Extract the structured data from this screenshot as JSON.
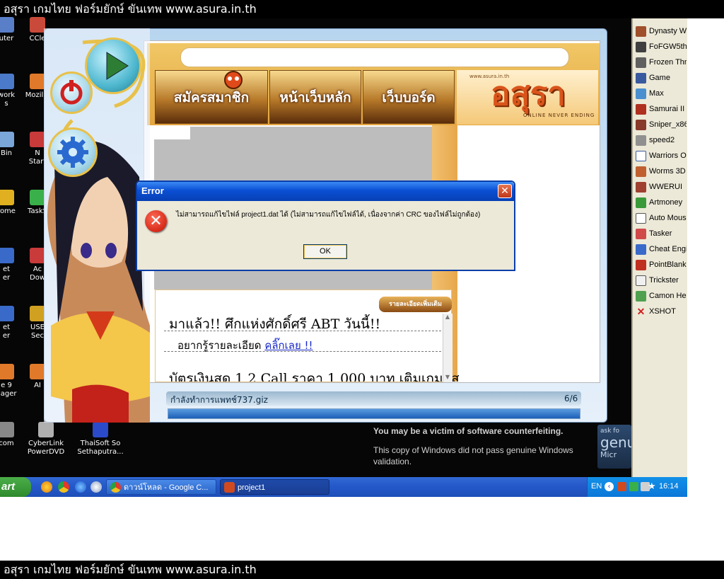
{
  "banner": {
    "top": "อสุรา เกมไทย ฟอร์มยักษ์ ขันเทพ www.asura.in.th",
    "bottom": "อสุรา เกมไทย ฟอร์มยักษ์ ขันเทพ www.asura.in.th"
  },
  "desktop_icons": [
    {
      "label": "uter",
      "icon": "computer-icon",
      "color": "#5a7fc9"
    },
    {
      "label": "CCle",
      "icon": "ccleaner-icon",
      "color": "#c94a3a"
    },
    {
      "label": "work\ns",
      "icon": "network-icon",
      "color": "#4a7ac9"
    },
    {
      "label": "Mozilla",
      "icon": "firefox-icon",
      "color": "#e07a2a"
    },
    {
      "label": "Bin",
      "icon": "recycle-bin-icon",
      "color": "#7aa6d9"
    },
    {
      "label": "N\nStart",
      "icon": "app-icon",
      "color": "#c93a3a"
    },
    {
      "label": "rome",
      "icon": "chrome-icon",
      "color": "#e0b020"
    },
    {
      "label": "TaskS",
      "icon": "tasks-icon",
      "color": "#3ab04a"
    },
    {
      "label": "et\ner",
      "icon": "internet-icon",
      "color": "#3a6ac9"
    },
    {
      "label": "Ac\nDow",
      "icon": "download-icon",
      "color": "#c93a3a"
    },
    {
      "label": "et\ner",
      "icon": "internet-icon",
      "color": "#3a6ac9"
    },
    {
      "label": "USE\nSec",
      "icon": "usb-icon",
      "color": "#d0a020"
    },
    {
      "label": "e 9\nnager",
      "icon": "manager-icon",
      "color": "#e07a2a"
    },
    {
      "label": "AI",
      "icon": "ai-icon",
      "color": "#e07a2a"
    },
    {
      "label": "com",
      "icon": "app-icon",
      "color": "#888888"
    },
    {
      "label": "CyberLink\nPowerDVD",
      "icon": "powerdvd-icon",
      "color": "#b0b0b0"
    },
    {
      "label": "ThaiSoft So\nSethaputra...",
      "icon": "thaisoft-icon",
      "color": "#2a4ac9"
    }
  ],
  "quicklaunch": [
    {
      "label": "Dynasty W",
      "color": "#a0502a"
    },
    {
      "label": "FoFGW5th",
      "color": "#404040"
    },
    {
      "label": "Frozen Thr",
      "color": "#606060"
    },
    {
      "label": "Game",
      "color": "#3a5aa0"
    },
    {
      "label": "Max",
      "color": "#4a90d0"
    },
    {
      "label": "Samurai II",
      "color": "#b03020"
    },
    {
      "label": "Sniper_x86",
      "color": "#8a3a2a"
    },
    {
      "label": "speed2",
      "color": "#909090"
    },
    {
      "label": "Warriors O",
      "color": "#ffffff"
    },
    {
      "label": "Worms 3D",
      "color": "#c06030"
    },
    {
      "label": "WWERUI",
      "color": "#a04030"
    },
    {
      "label": "Artmoney",
      "color": "#3a9a3a"
    },
    {
      "label": "Auto Mous",
      "color": "#ffffff"
    },
    {
      "label": "Tasker",
      "color": "#d04a4a"
    },
    {
      "label": "Cheat Engi",
      "color": "#3a6ac9"
    },
    {
      "label": "PointBlank",
      "color": "#c03020"
    },
    {
      "label": "Trickster",
      "color": "#f0f0f0"
    },
    {
      "label": "Camon Her",
      "color": "#50a050"
    },
    {
      "label": "XSHOT",
      "color": "#d02020"
    }
  ],
  "patcher": {
    "nav": [
      "สมัครสมาชิก",
      "หน้าเว็บหลัก",
      "เว็บบอร์ด"
    ],
    "logo_text": "อสุรา",
    "logo_url": "www.asura.in.th",
    "logo_sub": "ONLINE NEVER ENDING",
    "news_badge": "รายละเอียดเพิ่มเติม",
    "news_headline": "มาแล้ว!! ศึกแห่งศักดิ์ศรี ABT วันนี้!!",
    "news_more_prefix": "อยากรู้รายละเอียด ",
    "news_more_link": "คลิ๊กเลย !!",
    "news_line2": "บัตรเงินสด 1,2 Call ราคา 1,000 บาท เติมเกมอส",
    "progress_label": "กำลังทำการแพทช์737.giz",
    "progress_count": "6/6",
    "progress_fraction": 1.0
  },
  "dialog": {
    "title": "Error",
    "close": "✕",
    "icon": "✕",
    "message": "ไม่สามารถแก้ไขไฟล์ project1.dat ได้ (ไม่สามารถแก้ไขไฟล์ได้, เนื่องจากค่า CRC ของไฟล์ไม่ถูกต้อง)",
    "ok_label": "OK"
  },
  "genuine": {
    "title": "You may be a victim of software counterfeiting.",
    "body": "This copy of Windows did not pass genuine Windows validation.",
    "logo_small": "ask fo",
    "logo_big": "genu",
    "logo_sub": "Micr"
  },
  "taskbar": {
    "start_label": "art",
    "windows": [
      {
        "label": "ดาวน์โหลด - Google C...",
        "icon": "chrome-icon",
        "color": "#e0b020"
      },
      {
        "label": "project1",
        "icon": "patcher-icon",
        "color": "#d04a20"
      }
    ],
    "lang": "EN",
    "clock": "16:14"
  }
}
